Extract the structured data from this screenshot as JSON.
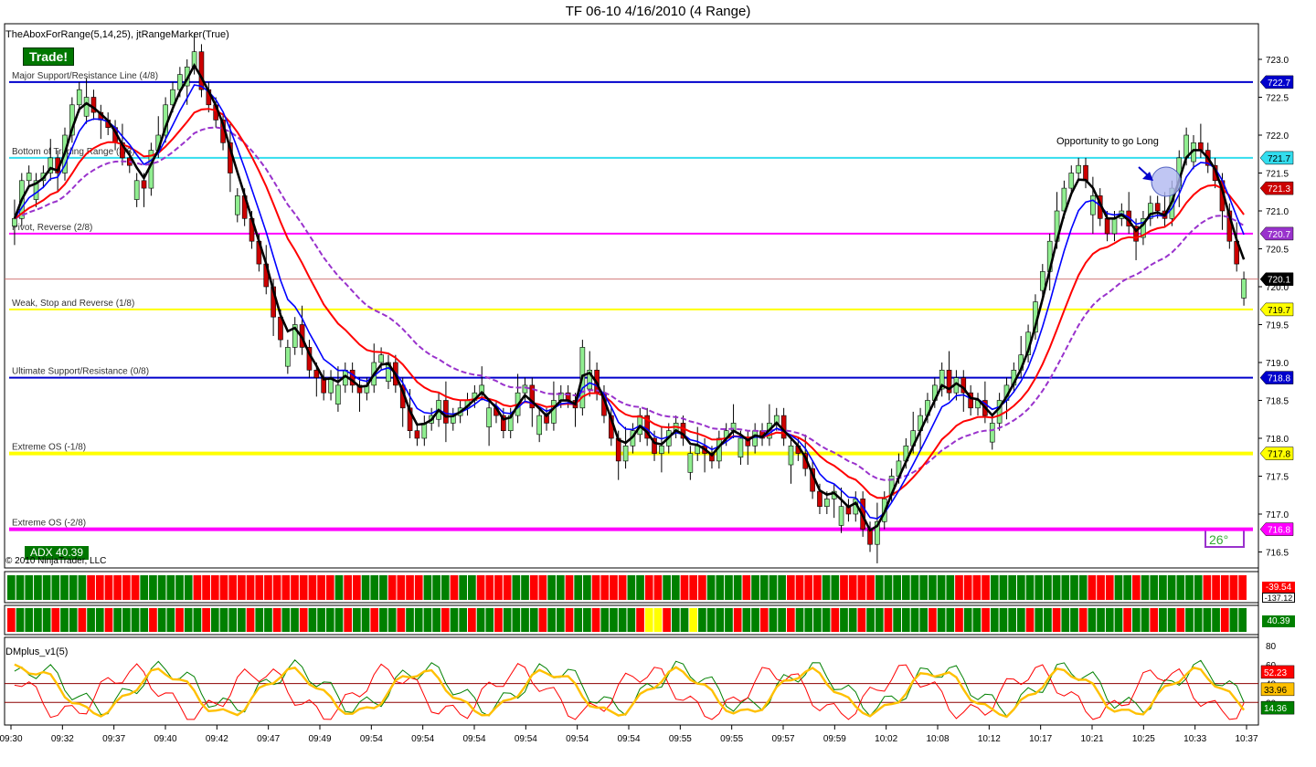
{
  "window": {
    "title": "TF 06-10  4/16/2010 (4 Range)"
  },
  "indicators": {
    "main_label": "TheAboxForRange(5,14,25), jtRangeMarker(True)",
    "trade_badge": "Trade!",
    "adx_badge": "ADX 40.39",
    "copyright": "© 2010 NinjaTrader, LLC",
    "angle_badge": "26°",
    "dmplus_label": "DMplus_v1(5)",
    "annotation": "Opportunity to go Long"
  },
  "colors": {
    "up": "#90ee90",
    "down": "#cc0000",
    "ema5": "#000000",
    "ema14": "#0000ff",
    "red_ma": "#ff0000",
    "ma25": "#9932cc",
    "bar_green": "#008000",
    "bar_red": "#ff0000",
    "bar_yellow": "#ffff00",
    "dm_green": "#008000",
    "dm_red": "#ff0000",
    "dm_gold": "#ffc000"
  },
  "chart_data": {
    "type": "candlestick",
    "title": "TF 06-10  4/16/2010 (4 Range)",
    "y_axis": {
      "ticks": [
        "723.0",
        "722.5",
        "722.0",
        "721.5",
        "721.0",
        "720.5",
        "720.0",
        "719.5",
        "719.0",
        "718.5",
        "718.0",
        "717.5",
        "717.0",
        "716.5"
      ],
      "range": [
        716.3,
        723.3
      ]
    },
    "x_labels": [
      "09:30",
      "09:32",
      "09:37",
      "09:40",
      "09:42",
      "09:47",
      "09:49",
      "09:54",
      "09:54",
      "09:54",
      "09:54",
      "09:54",
      "09:54",
      "09:55",
      "09:55",
      "09:57",
      "09:59",
      "10:02",
      "10:08",
      "10:12",
      "10:17",
      "10:21",
      "10:25",
      "10:33",
      "10:37"
    ],
    "levels": [
      {
        "name": "Major Support/Resistance Line (4/8)",
        "value": 722.7,
        "label": "722.7",
        "color": "#0000cc",
        "width": 2,
        "badge": "#0000cc",
        "badge_text": "#ffffff"
      },
      {
        "name": "Bottom of Trading Range (3/8)",
        "value": 721.7,
        "label": "721.7",
        "color": "#33ddee",
        "width": 2,
        "badge": "#33ddee",
        "badge_text": "#000000"
      },
      {
        "name": "Pivot, Reverse (2/8)",
        "value": 720.7,
        "label": "720.7",
        "color": "#ff00ff",
        "width": 2,
        "badge": "#9932cc",
        "badge_text": "#ffffff"
      },
      {
        "name": "Weak, Stop and Reverse (1/8)",
        "value": 719.7,
        "label": "719.7",
        "color": "#ffff00",
        "width": 2,
        "badge": "#ffff00",
        "badge_text": "#000000"
      },
      {
        "name": "Ultimate Support/Resistance (0/8)",
        "value": 718.8,
        "label": "718.8",
        "color": "#0000cc",
        "width": 2,
        "badge": "#0000cc",
        "badge_text": "#ffffff"
      },
      {
        "name": "Extreme OS (-1/8)",
        "value": 717.8,
        "label": "717.8",
        "color": "#ffff00",
        "width": 4,
        "badge": "#ffff00",
        "badge_text": "#000000"
      },
      {
        "name": "Extreme OS (-2/8)",
        "value": 716.8,
        "label": "716.8",
        "color": "#ff00ff",
        "width": 4,
        "badge": "#ff00ff",
        "badge_text": "#ffffff"
      }
    ],
    "price_badges": [
      {
        "value": 721.3,
        "label": "721.3",
        "bg": "#cc0000",
        "fg": "#ffffff"
      },
      {
        "value": 720.1,
        "label": "720.1",
        "bg": "#000000",
        "fg": "#ffffff"
      }
    ],
    "close_series": [
      720.9,
      721.4,
      721.5,
      721.4,
      721.5,
      721.7,
      721.5,
      722.0,
      722.4,
      722.6,
      722.5,
      722.3,
      722.2,
      722.1,
      721.9,
      721.7,
      721.6,
      721.4,
      721.3,
      721.8,
      722.0,
      722.4,
      722.6,
      722.8,
      722.9,
      723.1,
      722.6,
      722.4,
      722.2,
      721.9,
      721.5,
      721.2,
      720.9,
      720.6,
      720.3,
      720.0,
      719.6,
      719.3,
      719.2,
      719.5,
      719.2,
      718.9,
      718.8,
      718.6,
      718.8,
      718.7,
      718.9,
      718.7,
      718.6,
      718.7,
      719.0,
      719.1,
      719.0,
      718.7,
      718.4,
      718.1,
      718.0,
      718.2,
      718.3,
      718.5,
      718.2,
      718.3,
      718.4,
      718.5,
      718.6,
      718.7,
      718.4,
      718.3,
      718.1,
      718.3,
      718.6,
      718.7,
      718.4,
      718.3,
      718.2,
      718.5,
      718.6,
      718.5,
      718.4,
      719.2,
      718.9,
      718.6,
      718.3,
      718.0,
      717.7,
      717.9,
      718.1,
      718.3,
      718.0,
      717.8,
      717.9,
      718.1,
      718.2,
      718.0,
      717.8,
      717.9,
      717.8,
      717.7,
      718.0,
      718.1,
      718.2,
      718.0,
      717.9,
      718.1,
      718.0,
      718.2,
      718.3,
      718.0,
      717.9,
      717.8,
      717.6,
      717.3,
      717.1,
      717.2,
      717.3,
      717.1,
      717.0,
      717.2,
      716.8,
      716.6,
      716.9,
      717.2,
      717.5,
      717.7,
      717.9,
      718.1,
      718.3,
      718.5,
      718.7,
      718.9,
      718.6,
      718.8,
      718.6,
      718.4,
      718.5,
      718.3,
      718.2,
      718.5,
      718.7,
      718.9,
      719.1,
      719.4,
      719.8,
      720.2,
      720.6,
      721.0,
      721.3,
      721.5,
      721.6,
      721.4,
      721.2,
      720.9,
      720.7,
      720.9,
      721.0,
      720.8,
      720.6,
      720.9,
      721.1,
      721.0,
      720.9,
      721.3,
      721.7,
      722.0,
      721.9,
      721.8,
      721.6,
      721.4,
      721.0,
      720.6,
      720.3,
      720.1
    ]
  },
  "panels": {
    "hist1": {
      "value_label": "-39.54",
      "sub_label": "-137.12"
    },
    "hist2": {
      "value_label": "40.39"
    },
    "dm": {
      "ticks": [
        "80",
        "60",
        "40",
        "20"
      ],
      "labels": [
        {
          "v": "52.23",
          "bg": "#ff0000",
          "fg": "#ffffff"
        },
        {
          "v": "33.96",
          "bg": "#ffc000",
          "fg": "#000000"
        },
        {
          "v": "14.36",
          "bg": "#008000",
          "fg": "#ffffff"
        }
      ]
    }
  }
}
